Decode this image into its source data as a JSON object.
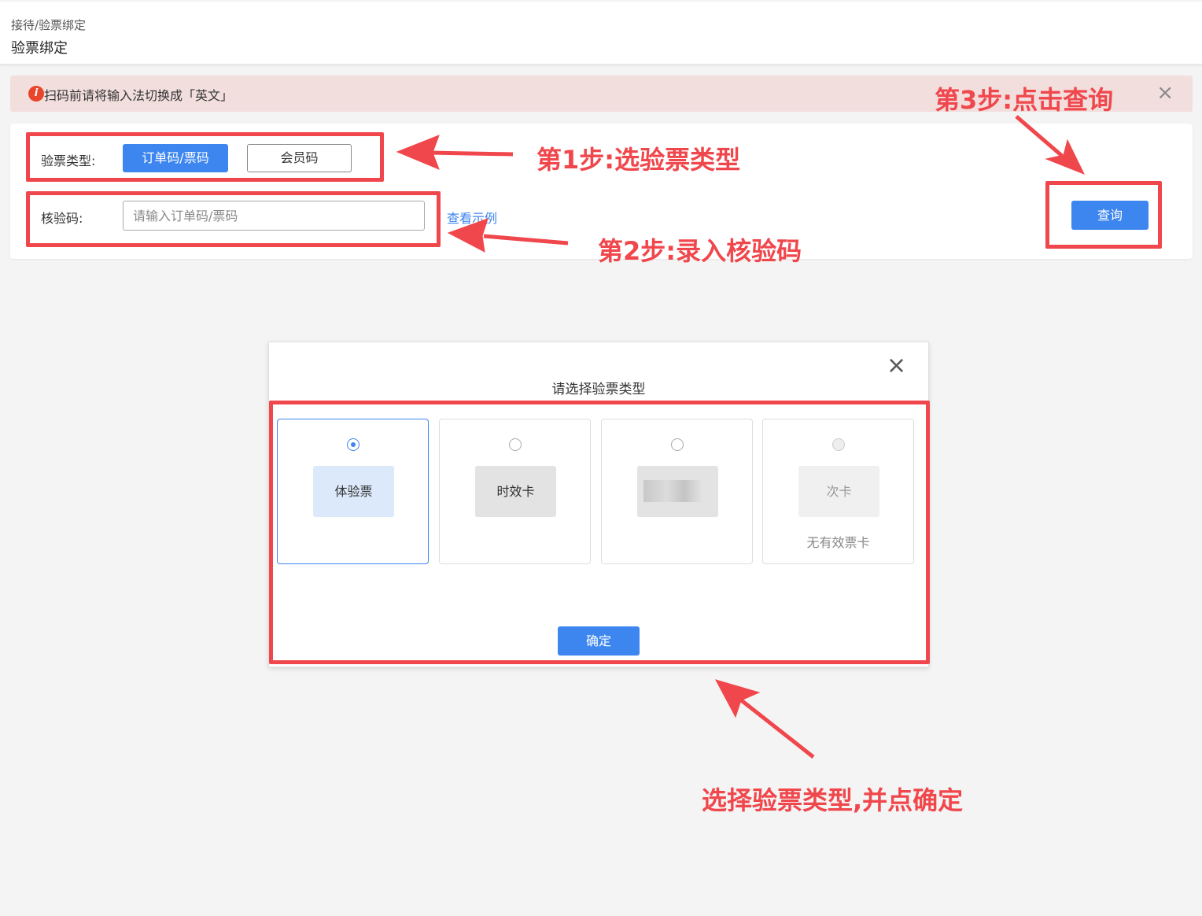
{
  "header": {
    "breadcrumb": "接待/验票绑定",
    "title": "验票绑定"
  },
  "alert": {
    "icon": "info-icon",
    "text": "扫码前请将输入法切换成「英文」",
    "close": "×"
  },
  "form": {
    "type_label": "验票类型:",
    "type_options": [
      {
        "label": "订单码/票码",
        "selected": true
      },
      {
        "label": "会员码",
        "selected": false
      }
    ],
    "code_label": "核验码:",
    "code_placeholder": "请输入订单码/票码",
    "code_value": "",
    "example_link": "查看示例",
    "query_button": "查询"
  },
  "dialog": {
    "title": "请选择验票类型",
    "close": "×",
    "options": [
      {
        "label": "体验票",
        "sub": "",
        "selected": true,
        "disabled": false
      },
      {
        "label": "时效卡",
        "sub": "",
        "selected": false,
        "disabled": false
      },
      {
        "label": "",
        "sub": "",
        "selected": false,
        "disabled": false
      },
      {
        "label": "次卡",
        "sub": "无有效票卡",
        "selected": false,
        "disabled": true
      }
    ],
    "confirm_button": "确定"
  },
  "annotations": {
    "step1": "第1步:选验票类型",
    "step2": "第2步:录入核验码",
    "step3": "第3步:点击查询",
    "step4": "选择验票类型,并点确定"
  },
  "colors": {
    "primary": "#3d86ef",
    "annotation": "#f0474c",
    "alert_bg": "#f3dede"
  }
}
